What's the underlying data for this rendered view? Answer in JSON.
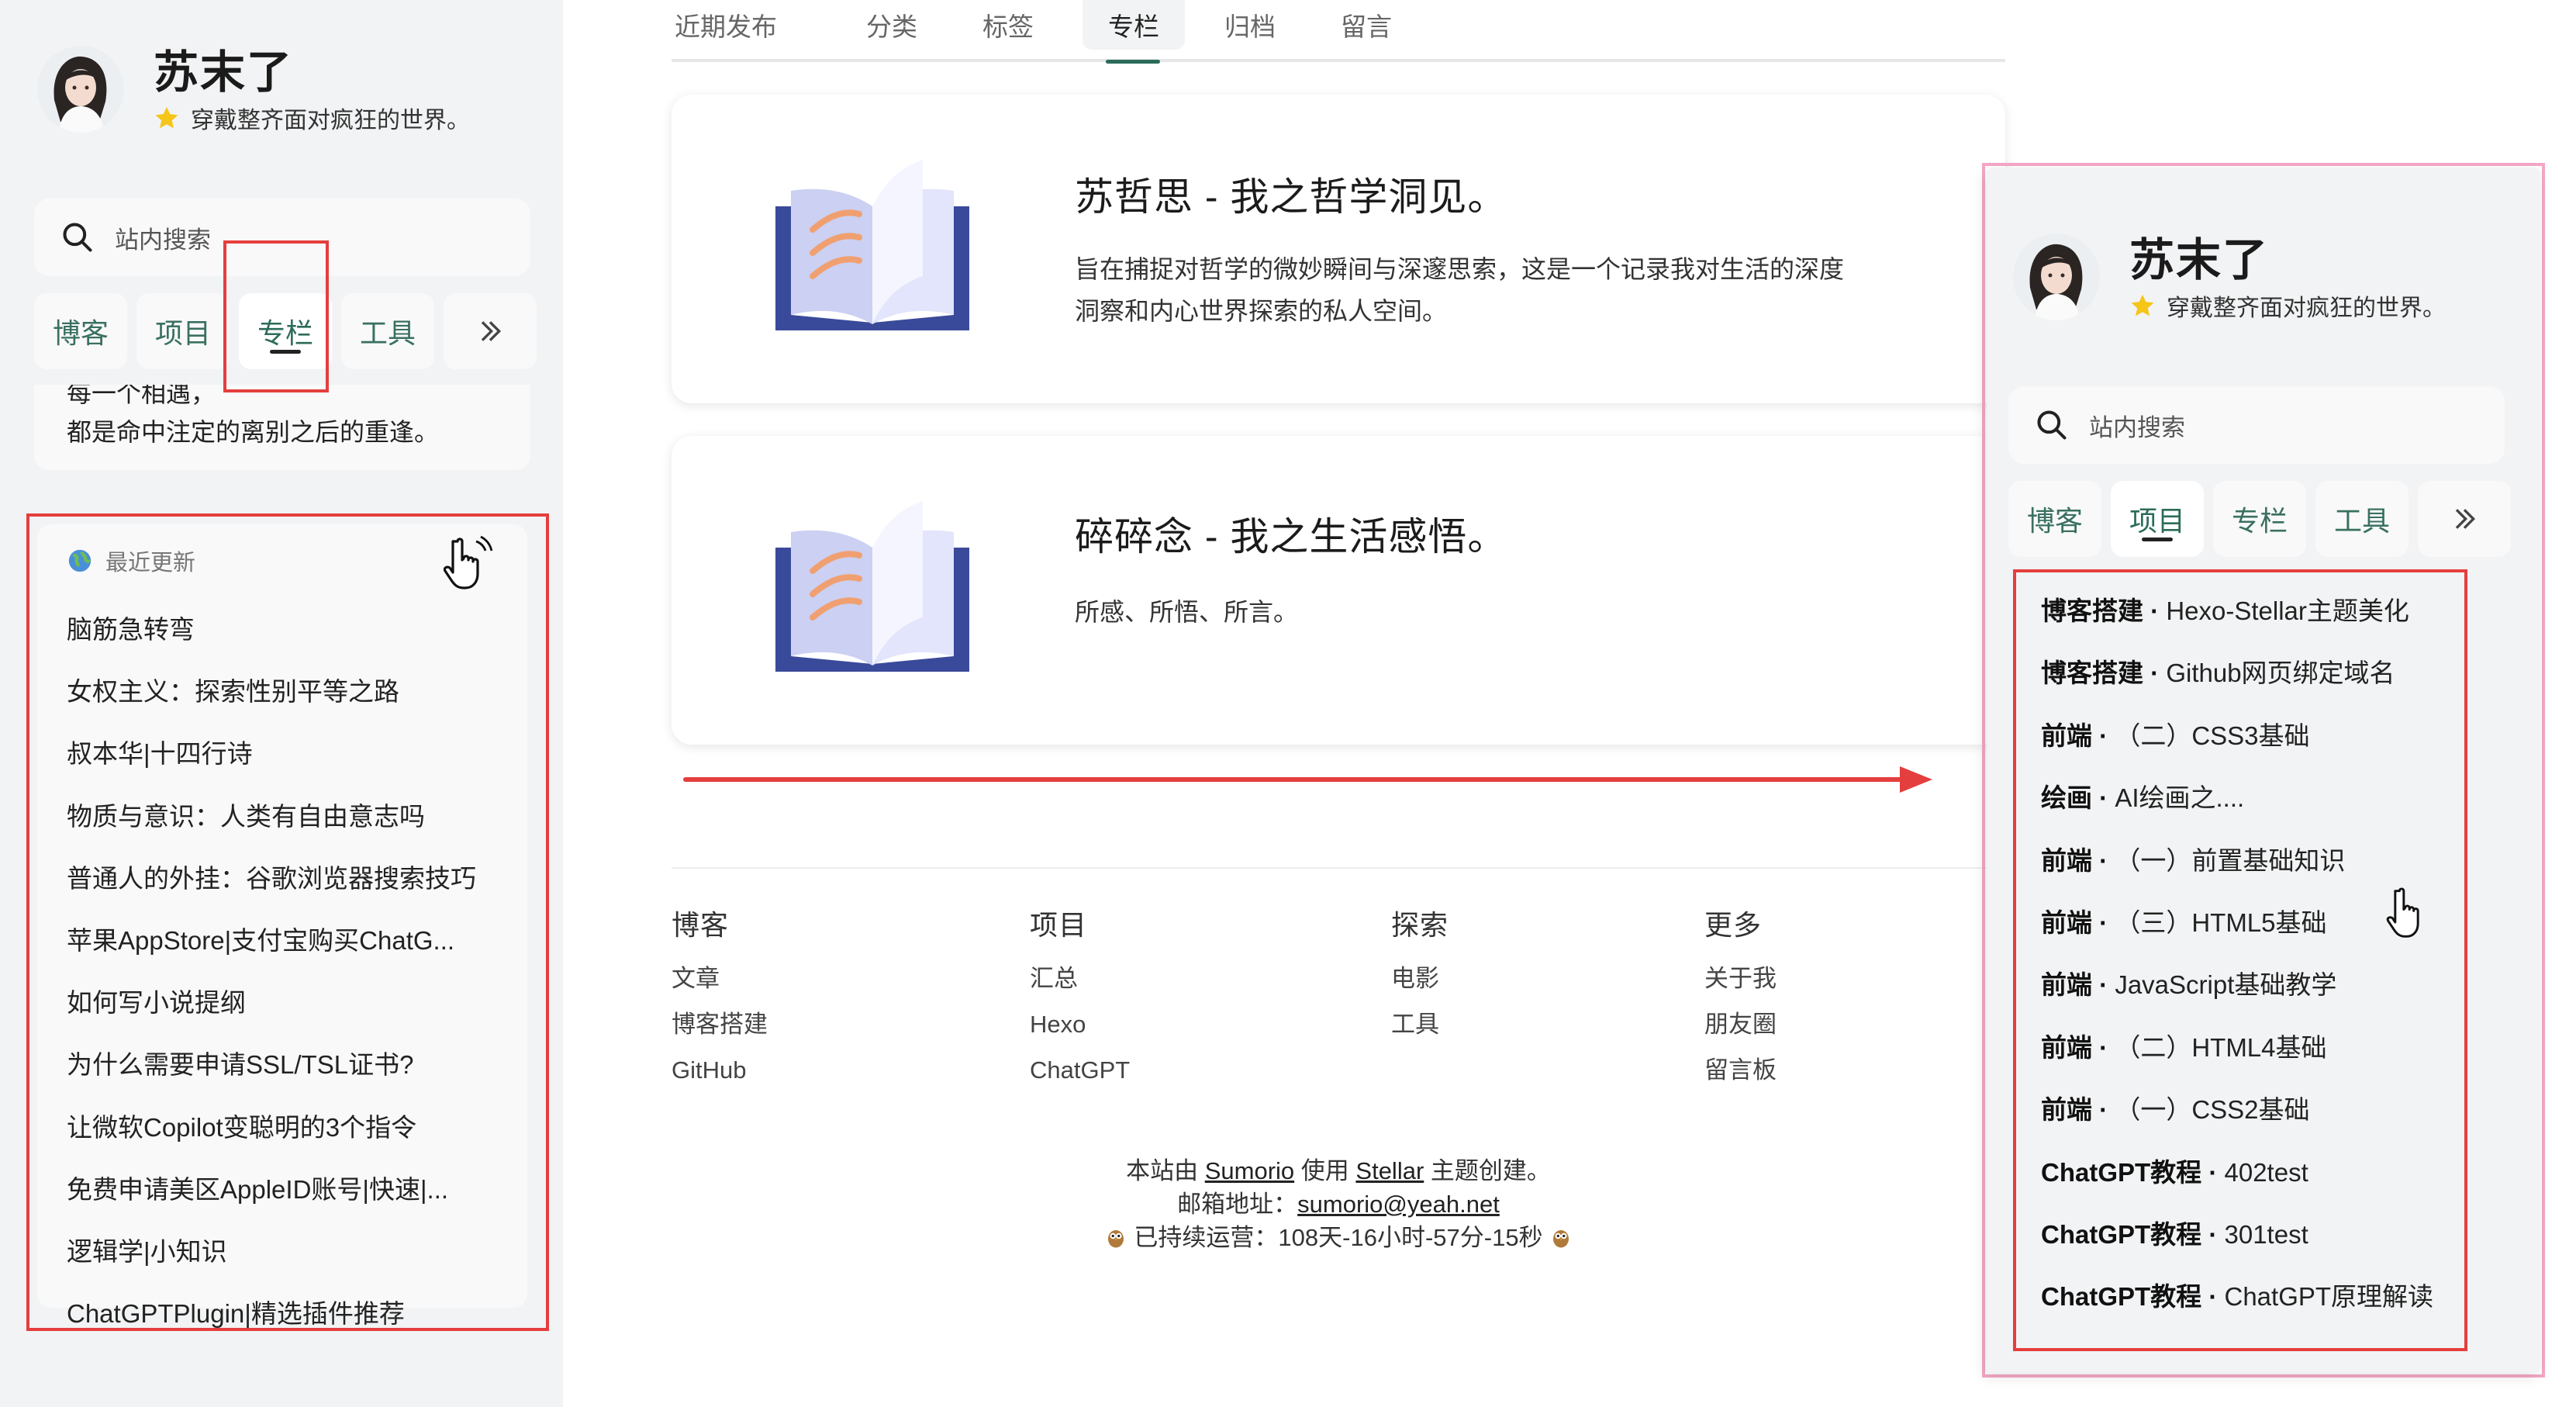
{
  "profile": {
    "name": "苏末了",
    "motto": "穿戴整齐面对疯狂的世界。"
  },
  "search": {
    "placeholder": "站内搜索"
  },
  "nav_tabs": [
    "博客",
    "项目",
    "专栏",
    "工具"
  ],
  "quote": {
    "line1": "每一个相遇，",
    "line2": "都是命中注定的离别之后的重逢。"
  },
  "recent": {
    "title": "最近更新",
    "items": [
      "脑筋急转弯",
      "女权主义：探索性别平等之路",
      "叔本华|十四行诗",
      "物质与意识：人类有自由意志吗",
      "普通人的外挂：谷歌浏览器搜索技巧",
      "苹果AppStore|支付宝购买ChatG...",
      "如何写小说提纲",
      "为什么需要申请SSL/TSL证书?",
      "让微软Copilot变聪明的3个指令",
      "免费申请美区AppleID账号|快速|...",
      "逻辑学|小知识",
      "ChatGPTPlugin|精选插件推荐"
    ]
  },
  "top_tabs": [
    "近期发布",
    "分类",
    "标签",
    "专栏",
    "归档",
    "留言"
  ],
  "columns": [
    {
      "title": "苏哲思 - 我之哲学洞见。",
      "desc_line1": "旨在捕捉对哲学的微妙瞬间与深邃思索，这是一个记录我对生活的深度",
      "desc_line2": "洞察和内心世界探索的私人空间。"
    },
    {
      "title": "碎碎念 - 我之生活感悟。",
      "desc_line1": "所感、所悟、所言。",
      "desc_line2": ""
    }
  ],
  "footer": {
    "cols": [
      {
        "title": "博客",
        "links": [
          "文章",
          "博客搭建",
          "GitHub"
        ]
      },
      {
        "title": "项目",
        "links": [
          "汇总",
          "Hexo",
          "ChatGPT"
        ]
      },
      {
        "title": "探索",
        "links": [
          "电影",
          "工具"
        ]
      },
      {
        "title": "更多",
        "links": [
          "关于我",
          "朋友圈",
          "留言板"
        ]
      }
    ],
    "line1_pre": "本站由",
    "line1_author": "Sumorio",
    "line1_mid": "使用",
    "line1_theme": "Stellar",
    "line1_post": "主题创建。",
    "line2_pre": "邮箱地址：",
    "line2_email": "sumorio@yeah.net",
    "line3": "已持续运营：108天-16小时-57分-15秒"
  },
  "projects": [
    {
      "cat": "博客搭建",
      "title": "Hexo-Stellar主题美化"
    },
    {
      "cat": "博客搭建",
      "title": "Github网页绑定域名"
    },
    {
      "cat": "前端",
      "title": "（二）CSS3基础"
    },
    {
      "cat": "绘画",
      "title": "AI绘画之...."
    },
    {
      "cat": "前端",
      "title": "（一）前置基础知识"
    },
    {
      "cat": "前端",
      "title": "（三）HTML5基础"
    },
    {
      "cat": "前端",
      "title": "JavaScript基础教学"
    },
    {
      "cat": "前端",
      "title": "（二）HTML4基础"
    },
    {
      "cat": "前端",
      "title": "（一）CSS2基础"
    },
    {
      "cat": "ChatGPT教程",
      "title": "402test"
    },
    {
      "cat": "ChatGPT教程",
      "title": "301test"
    },
    {
      "cat": "ChatGPT教程",
      "title": "ChatGPT原理解读"
    }
  ],
  "colors": {
    "accent": "#2c6b5a",
    "highlight_red": "#e53e3e",
    "highlight_pink": "#f4a7c6",
    "book_blue": "#3a4a9a",
    "book_stripe": "#f0a070"
  }
}
